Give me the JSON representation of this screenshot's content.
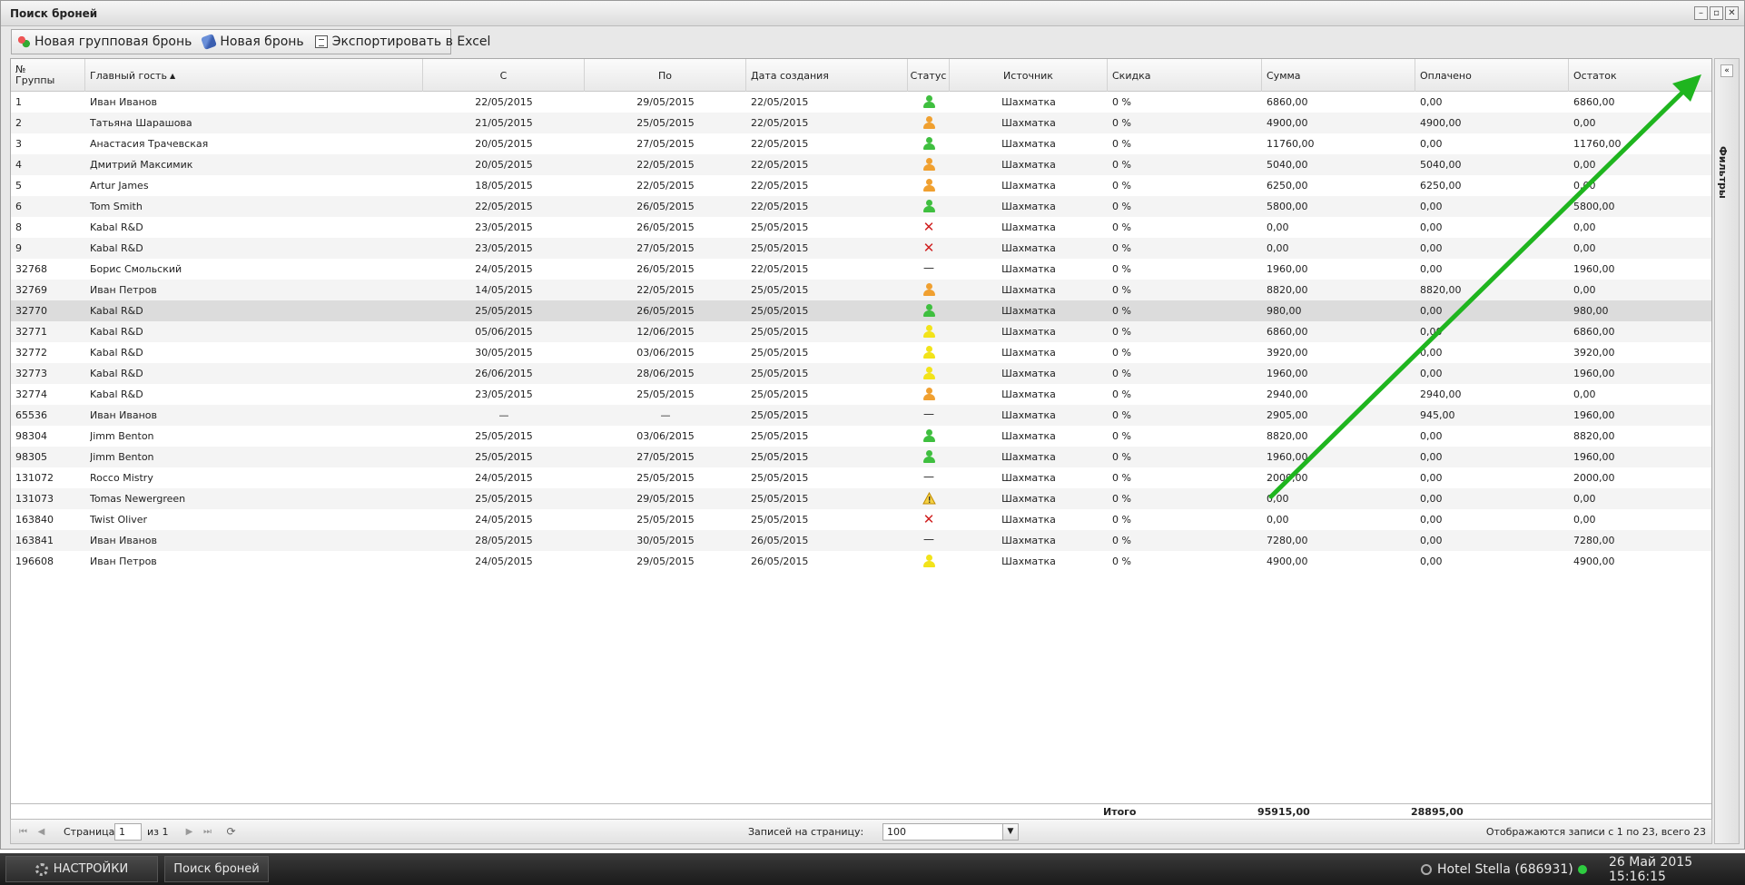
{
  "window": {
    "title": "Поиск броней"
  },
  "toolbar": {
    "new_group": "Новая групповая бронь",
    "new_booking": "Новая бронь",
    "export": "Экспортировать в Excel"
  },
  "columns": {
    "group": "№ Группы",
    "guest": "Главный гость",
    "from": "С",
    "to": "По",
    "created": "Дата создания",
    "status": "Статус",
    "source": "Источник",
    "discount": "Скидка",
    "sum": "Сумма",
    "paid": "Оплачено",
    "rest": "Остаток"
  },
  "status_colors": {
    "green": "#3fbf3f",
    "orange": "#f0a030",
    "yellow": "#f2e31a"
  },
  "rows": [
    {
      "group": "1",
      "guest": "Иван Иванов",
      "from": "22/05/2015",
      "to": "29/05/2015",
      "created": "22/05/2015",
      "status": "green",
      "source": "Шахматка",
      "discount": "0 %",
      "sum": "6860,00",
      "paid": "0,00",
      "rest": "6860,00"
    },
    {
      "group": "2",
      "guest": "Татьяна Шарашова",
      "from": "21/05/2015",
      "to": "25/05/2015",
      "created": "22/05/2015",
      "status": "orange",
      "source": "Шахматка",
      "discount": "0 %",
      "sum": "4900,00",
      "paid": "4900,00",
      "rest": "0,00"
    },
    {
      "group": "3",
      "guest": "Анастасия Трачевская",
      "from": "20/05/2015",
      "to": "27/05/2015",
      "created": "22/05/2015",
      "status": "green",
      "source": "Шахматка",
      "discount": "0 %",
      "sum": "11760,00",
      "paid": "0,00",
      "rest": "11760,00"
    },
    {
      "group": "4",
      "guest": "Дмитрий Максимик",
      "from": "20/05/2015",
      "to": "22/05/2015",
      "created": "22/05/2015",
      "status": "orange",
      "source": "Шахматка",
      "discount": "0 %",
      "sum": "5040,00",
      "paid": "5040,00",
      "rest": "0,00"
    },
    {
      "group": "5",
      "guest": "Artur James",
      "from": "18/05/2015",
      "to": "22/05/2015",
      "created": "22/05/2015",
      "status": "orange",
      "source": "Шахматка",
      "discount": "0 %",
      "sum": "6250,00",
      "paid": "6250,00",
      "rest": "0,00"
    },
    {
      "group": "6",
      "guest": "Tom Smith",
      "from": "22/05/2015",
      "to": "26/05/2015",
      "created": "22/05/2015",
      "status": "green",
      "source": "Шахматка",
      "discount": "0 %",
      "sum": "5800,00",
      "paid": "0,00",
      "rest": "5800,00"
    },
    {
      "group": "8",
      "guest": "Kabal R&D",
      "from": "23/05/2015",
      "to": "26/05/2015",
      "created": "25/05/2015",
      "status": "cancel",
      "source": "Шахматка",
      "discount": "0 %",
      "sum": "0,00",
      "paid": "0,00",
      "rest": "0,00"
    },
    {
      "group": "9",
      "guest": "Kabal R&D",
      "from": "23/05/2015",
      "to": "27/05/2015",
      "created": "25/05/2015",
      "status": "cancel",
      "source": "Шахматка",
      "discount": "0 %",
      "sum": "0,00",
      "paid": "0,00",
      "rest": "0,00"
    },
    {
      "group": "32768",
      "guest": "Борис Смольский",
      "from": "24/05/2015",
      "to": "26/05/2015",
      "created": "22/05/2015",
      "status": "none",
      "source": "Шахматка",
      "discount": "0 %",
      "sum": "1960,00",
      "paid": "0,00",
      "rest": "1960,00"
    },
    {
      "group": "32769",
      "guest": "Иван Петров",
      "from": "14/05/2015",
      "to": "22/05/2015",
      "created": "25/05/2015",
      "status": "orange",
      "source": "Шахматка",
      "discount": "0 %",
      "sum": "8820,00",
      "paid": "8820,00",
      "rest": "0,00"
    },
    {
      "group": "32770",
      "guest": "Kabal R&D",
      "from": "25/05/2015",
      "to": "26/05/2015",
      "created": "25/05/2015",
      "status": "green",
      "source": "Шахматка",
      "discount": "0 %",
      "sum": "980,00",
      "paid": "0,00",
      "rest": "980,00",
      "selected": true
    },
    {
      "group": "32771",
      "guest": "Kabal R&D",
      "from": "05/06/2015",
      "to": "12/06/2015",
      "created": "25/05/2015",
      "status": "yellow",
      "source": "Шахматка",
      "discount": "0 %",
      "sum": "6860,00",
      "paid": "0,00",
      "rest": "6860,00"
    },
    {
      "group": "32772",
      "guest": "Kabal R&D",
      "from": "30/05/2015",
      "to": "03/06/2015",
      "created": "25/05/2015",
      "status": "yellow",
      "source": "Шахматка",
      "discount": "0 %",
      "sum": "3920,00",
      "paid": "0,00",
      "rest": "3920,00"
    },
    {
      "group": "32773",
      "guest": "Kabal R&D",
      "from": "26/06/2015",
      "to": "28/06/2015",
      "created": "25/05/2015",
      "status": "yellow",
      "source": "Шахматка",
      "discount": "0 %",
      "sum": "1960,00",
      "paid": "0,00",
      "rest": "1960,00"
    },
    {
      "group": "32774",
      "guest": "Kabal R&D",
      "from": "23/05/2015",
      "to": "25/05/2015",
      "created": "25/05/2015",
      "status": "orange",
      "source": "Шахматка",
      "discount": "0 %",
      "sum": "2940,00",
      "paid": "2940,00",
      "rest": "0,00"
    },
    {
      "group": "65536",
      "guest": "Иван Иванов",
      "from": "—",
      "to": "—",
      "created": "25/05/2015",
      "status": "none",
      "source": "Шахматка",
      "discount": "0 %",
      "sum": "2905,00",
      "paid": "945,00",
      "rest": "1960,00"
    },
    {
      "group": "98304",
      "guest": "Jimm Benton",
      "from": "25/05/2015",
      "to": "03/06/2015",
      "created": "25/05/2015",
      "status": "green",
      "source": "Шахматка",
      "discount": "0 %",
      "sum": "8820,00",
      "paid": "0,00",
      "rest": "8820,00"
    },
    {
      "group": "98305",
      "guest": "Jimm Benton",
      "from": "25/05/2015",
      "to": "27/05/2015",
      "created": "25/05/2015",
      "status": "green",
      "source": "Шахматка",
      "discount": "0 %",
      "sum": "1960,00",
      "paid": "0,00",
      "rest": "1960,00"
    },
    {
      "group": "131072",
      "guest": "Rocco Mistry",
      "from": "24/05/2015",
      "to": "25/05/2015",
      "created": "25/05/2015",
      "status": "none",
      "source": "Шахматка",
      "discount": "0 %",
      "sum": "2000,00",
      "paid": "0,00",
      "rest": "2000,00"
    },
    {
      "group": "131073",
      "guest": "Tomas Newergreen",
      "from": "25/05/2015",
      "to": "29/05/2015",
      "created": "25/05/2015",
      "status": "warning",
      "source": "Шахматка",
      "discount": "0 %",
      "sum": "0,00",
      "paid": "0,00",
      "rest": "0,00"
    },
    {
      "group": "163840",
      "guest": "Twist Oliver",
      "from": "24/05/2015",
      "to": "25/05/2015",
      "created": "25/05/2015",
      "status": "cancel",
      "source": "Шахматка",
      "discount": "0 %",
      "sum": "0,00",
      "paid": "0,00",
      "rest": "0,00"
    },
    {
      "group": "163841",
      "guest": "Иван Иванов",
      "from": "28/05/2015",
      "to": "30/05/2015",
      "created": "26/05/2015",
      "status": "none",
      "source": "Шахматка",
      "discount": "0 %",
      "sum": "7280,00",
      "paid": "0,00",
      "rest": "7280,00"
    },
    {
      "group": "196608",
      "guest": "Иван Петров",
      "from": "24/05/2015",
      "to": "29/05/2015",
      "created": "26/05/2015",
      "status": "yellow",
      "source": "Шахматка",
      "discount": "0 %",
      "sum": "4900,00",
      "paid": "0,00",
      "rest": "4900,00"
    }
  ],
  "totals": {
    "label": "Итого",
    "sum": "95915,00",
    "paid": "28895,00"
  },
  "pager": {
    "page_label": "Страница",
    "page_value": "1",
    "of_label": "из 1",
    "per_page_label": "Записей на страницу:",
    "per_page_value": "100",
    "summary": "Отображаются записи с 1 по 23, всего 23"
  },
  "side_panel": {
    "label": "Фильтры"
  },
  "taskbar": {
    "settings": "НАСТРОЙКИ",
    "search": "Поиск броней",
    "hotel": "Hotel Stella (686931)",
    "datetime": "26 Май 2015 15:16:15"
  },
  "annotation": {
    "arrow_color": "#1fb51f"
  }
}
